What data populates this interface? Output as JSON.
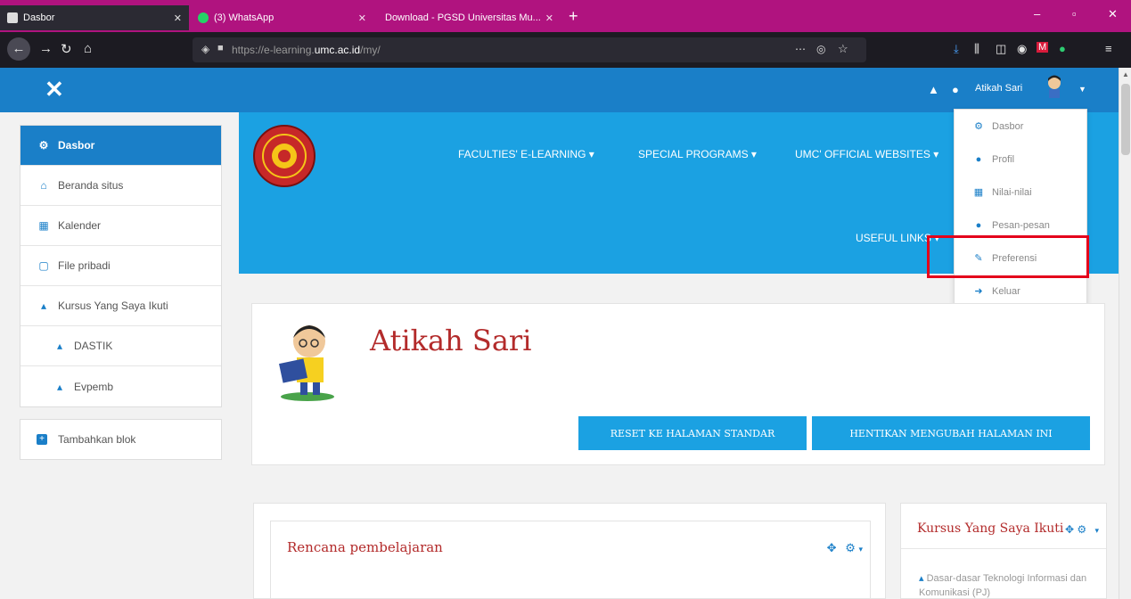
{
  "browser": {
    "tabs": [
      {
        "title": "Dasbor",
        "active": true
      },
      {
        "title": "(3) WhatsApp",
        "active": false
      },
      {
        "title": "Download - PGSD Universitas Mu...",
        "active": false
      }
    ],
    "url_prefix": "https://e-learning.",
    "url_domain": "umc.ac.id",
    "url_suffix": "/my/"
  },
  "header": {
    "user_name": "Atikah Sari"
  },
  "sidebar": {
    "items": [
      {
        "label": "Dasbor",
        "icon": "tachometer-icon",
        "glyph": "⚙",
        "active": true,
        "sub": false
      },
      {
        "label": "Beranda situs",
        "icon": "home-icon",
        "glyph": "⌂",
        "active": false,
        "sub": false
      },
      {
        "label": "Kalender",
        "icon": "calendar-icon",
        "glyph": "▦",
        "active": false,
        "sub": false
      },
      {
        "label": "File pribadi",
        "icon": "file-icon",
        "glyph": "▢",
        "active": false,
        "sub": false
      },
      {
        "label": "Kursus Yang Saya Ikuti",
        "icon": "graduation-cap-icon",
        "glyph": "▴",
        "active": false,
        "sub": false
      },
      {
        "label": "DASTIK",
        "icon": "graduation-cap-icon",
        "glyph": "▴",
        "active": false,
        "sub": true
      },
      {
        "label": "Evpemb",
        "icon": "graduation-cap-icon",
        "glyph": "▴",
        "active": false,
        "sub": true
      }
    ],
    "add_block_label": "Tambahkan blok"
  },
  "banner": {
    "menus": [
      {
        "label": "FACULTIES' E-LEARNING ▾"
      },
      {
        "label": "SPECIAL PROGRAMS ▾"
      },
      {
        "label": "UMC' OFFICIAL WEBSITES ▾"
      },
      {
        "label": "USEFUL LINKS ▾"
      }
    ]
  },
  "user_menu": {
    "items": [
      {
        "label": "Dasbor",
        "icon": "tachometer-icon",
        "glyph": "⚙"
      },
      {
        "label": "Profil",
        "icon": "user-icon",
        "glyph": "●"
      },
      {
        "label": "Nilai-nilai",
        "icon": "table-icon",
        "glyph": "▦"
      },
      {
        "label": "Pesan-pesan",
        "icon": "comment-icon",
        "glyph": "●"
      },
      {
        "label": "Preferensi",
        "icon": "wrench-icon",
        "glyph": "✎"
      },
      {
        "label": "Keluar",
        "icon": "sign-out-icon",
        "glyph": "➜"
      }
    ]
  },
  "profile": {
    "name": "Atikah Sari",
    "reset_button": "RESET KE HALAMAN STANDAR",
    "stop_button": "HENTIKAN MENGUBAH HALAMAN INI"
  },
  "blocks": {
    "plan_title": "Rencana pembelajaran",
    "courses_title": "Kursus Yang Saya Ikuti",
    "course_item": "Dasar-dasar Teknologi Informasi dan Komunikasi (PJ)"
  },
  "colors": {
    "header_blue": "#1a7fc8",
    "banner_blue": "#1ba1e2",
    "title_red": "#b32b2b",
    "tabbar_magenta": "#b0137f",
    "highlight_red": "#e4001b"
  }
}
